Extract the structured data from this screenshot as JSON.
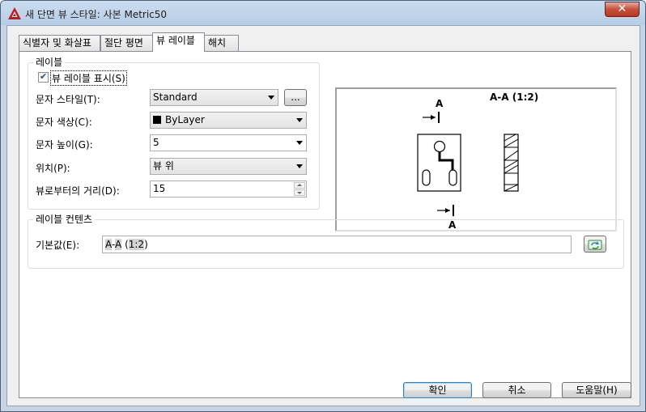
{
  "window": {
    "title": "새 단면 뷰 스타일: 사본 Metric50",
    "close_label": "✕"
  },
  "tabs": [
    {
      "label": "식별자 및 화살표",
      "active": false
    },
    {
      "label": "절단 평면",
      "active": false
    },
    {
      "label": "뷰 레이블",
      "active": true
    },
    {
      "label": "해치",
      "active": false
    }
  ],
  "label_group": {
    "legend": "레이블",
    "show_label": {
      "text": "뷰 레이블 표시(S)",
      "checked": true
    },
    "text_style": {
      "label": "문자 스타일(T):",
      "value": "Standard",
      "browse_label": "..."
    },
    "text_color": {
      "label": "문자 색상(C):",
      "value": "ByLayer",
      "swatch_color": "#000000"
    },
    "text_height": {
      "label": "문자 높이(G):",
      "value": "5"
    },
    "location": {
      "label": "위치(P):",
      "value": "뷰 위"
    },
    "distance": {
      "label": "뷰로부터의 거리(D):",
      "value": "15"
    }
  },
  "preview": {
    "view_label": "A-A (1:2)",
    "top_identifier": "A",
    "bottom_identifier": "A"
  },
  "contents_group": {
    "legend": "레이블 컨텐츠",
    "default_label": "기본값(E):",
    "default_parts": [
      "A",
      "-",
      "A",
      " (",
      "1:2",
      ")"
    ],
    "field_icon": "field-update-icon"
  },
  "buttons": {
    "ok": "확인",
    "cancel": "취소",
    "help": "도움말(H)"
  }
}
